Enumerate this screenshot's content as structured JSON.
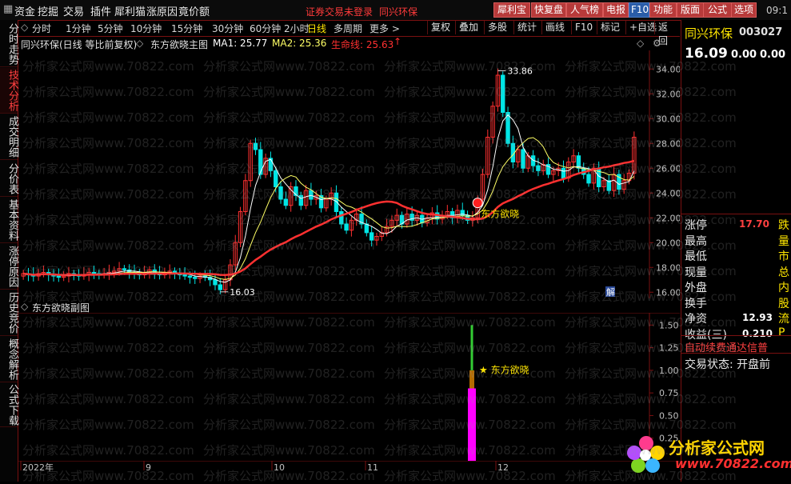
{
  "menu": {
    "items": [
      "资金",
      "挖掘",
      "交易",
      "插件",
      "犀利猫",
      "涨原因",
      "竟价额"
    ],
    "notice": "证券交易未登录",
    "notice2": "同兴环保",
    "tools": [
      "犀利宝",
      "快复盘",
      "人气榜",
      "电报",
      "F10",
      "功能",
      "版面",
      "公式",
      "选项"
    ],
    "clock": "09:1"
  },
  "left_tabs": [
    "分时走势",
    "技术分析",
    "成交明细",
    "分价表",
    "基本资料",
    "涨停原因",
    "历史竞价",
    "概念解析",
    "公式下载"
  ],
  "toolbar": {
    "periods": [
      "分时",
      "1分钟",
      "5分钟",
      "10分钟",
      "15分钟",
      "30分钟",
      "60分钟",
      "2小时",
      "日线",
      "多周期",
      "更多 >"
    ],
    "active_period": "日线",
    "right_buttons": [
      "复权",
      "叠加",
      "多股",
      "统计",
      "画线",
      "F10",
      "标记",
      "+自选",
      "返回"
    ]
  },
  "info": {
    "title": "同兴环保(日线 等比前复权)",
    "indicator": "东方欲晓主图",
    "ma1": "MA1: 25.77",
    "ma2": "MA2: 25.36",
    "life": "生命线: 25.63",
    "ma1_color": "#ffffff",
    "ma2_color": "#ffff66",
    "life_color": "#ff3030"
  },
  "sub_chart": {
    "title": "东方欲晓副图",
    "signal_label": "★ 东方欲晓"
  },
  "right": {
    "name": "同兴环保",
    "code": "003027",
    "price": "16.09",
    "chg1": "0.00",
    "chg2": "0.00",
    "rows": [
      {
        "label": "涨停",
        "value": "17.70",
        "extra": "跌"
      },
      {
        "label": "最高",
        "value": "",
        "extra": "量"
      },
      {
        "label": "最低",
        "value": "",
        "extra": "市"
      },
      {
        "label": "现量",
        "value": "",
        "extra": "总"
      },
      {
        "label": "外盘",
        "value": "",
        "extra": "内"
      },
      {
        "label": "换手",
        "value": "",
        "extra": "股"
      },
      {
        "label": "净资",
        "value": "12.93",
        "extra": "流"
      },
      {
        "label": "收益(三)",
        "value": "0.210",
        "extra": "P"
      }
    ],
    "scroll_text": "自动续费通达信普",
    "status": "交易状态: 开盘前"
  },
  "watermark": "分析家公式网www.70822.com",
  "logo": {
    "title": "分析家公式网",
    "url": "www.70822.com"
  },
  "chart_data": [
    {
      "type": "candlestick",
      "title": "东方欲晓主图",
      "ylim": [
        15.5,
        35.5
      ],
      "y_ticks": [
        16,
        18,
        20,
        22,
        24,
        26,
        28,
        30,
        32,
        34
      ],
      "x_labels": [
        "2022年",
        "9",
        "10",
        "11",
        "12"
      ],
      "annotations": [
        {
          "text": "16.03",
          "value": 16.03
        },
        {
          "text": "33.86",
          "value": 33.86
        },
        {
          "text": "东方欲晓",
          "value": 23.2
        }
      ],
      "series": [
        {
          "name": "MA1",
          "color": "#ffffff"
        },
        {
          "name": "MA2",
          "color": "#ffff66"
        },
        {
          "name": "生命线",
          "color": "#ff3030"
        }
      ],
      "closes": [
        17.5,
        17.4,
        17.3,
        17.5,
        17.6,
        17.4,
        17.3,
        17.2,
        17.3,
        17.5,
        17.4,
        17.3,
        17.4,
        17.6,
        17.5,
        17.4,
        17.5,
        17.6,
        17.7,
        17.9,
        17.8,
        17.6,
        17.5,
        17.4,
        17.6,
        17.8,
        17.5,
        17.4,
        17.6,
        17.7,
        17.5,
        17.4,
        17.3,
        17.2,
        17.1,
        17.3,
        17.2,
        17.0,
        16.6,
        16.2,
        17.0,
        18.2,
        20.0,
        22.5,
        25.0,
        28.0,
        27.5,
        25.5,
        26.8,
        25.8,
        24.5,
        23.5,
        23.0,
        24.5,
        23.8,
        23.0,
        24.2,
        23.5,
        23.8,
        22.8,
        23.5,
        24.0,
        22.5,
        21.5,
        21.0,
        21.8,
        22.3,
        21.5,
        20.8,
        20.2,
        20.5,
        20.8,
        21.3,
        21.8,
        22.2,
        21.5,
        22.3,
        21.8,
        22.2,
        21.6,
        22.0,
        22.4,
        21.9,
        22.2,
        22.5,
        22.0,
        22.6,
        22.2,
        21.8,
        22.0,
        23.5,
        25.5,
        28.5,
        31.0,
        33.5,
        30.5,
        28.0,
        26.5,
        27.5,
        26.0,
        27.0,
        26.2,
        25.8,
        26.3,
        25.5,
        25.8,
        26.0,
        25.2,
        26.5,
        27.0,
        26.0,
        25.5,
        24.8,
        26.0,
        24.5,
        25.0,
        24.2,
        25.5,
        24.3,
        25.0,
        25.6,
        28.5
      ]
    },
    {
      "type": "bar",
      "title": "东方欲晓副图",
      "ylim": [
        0,
        1.6
      ],
      "y_ticks": [
        0.25,
        0.5,
        0.75,
        1.0,
        1.25,
        1.5
      ],
      "series": [
        {
          "name": "东方欲晓",
          "segments": [
            {
              "from": 0,
              "to": 0.8,
              "color": "#ff00ff"
            },
            {
              "from": 0.8,
              "to": 1.0,
              "color": "#b36b00"
            },
            {
              "from": 1.0,
              "to": 1.5,
              "color": "#33cc33"
            }
          ]
        }
      ]
    }
  ]
}
